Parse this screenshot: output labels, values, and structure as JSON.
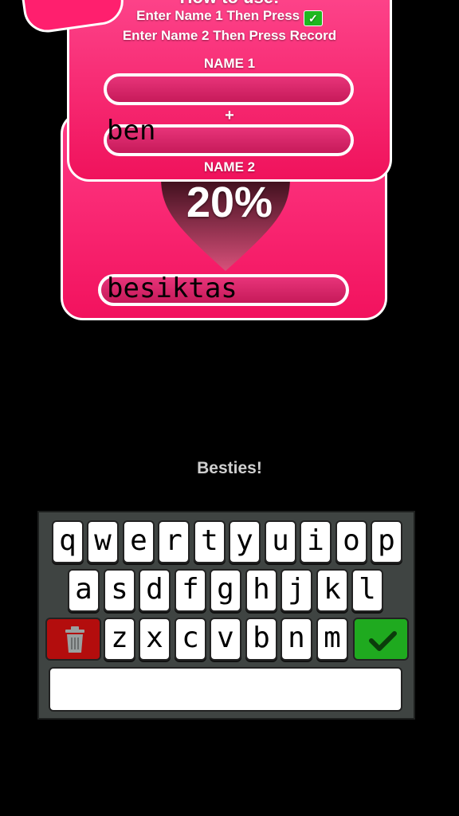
{
  "card": {
    "title": "How to use:",
    "instruction_1": "Enter Name 1 Then Press",
    "instruction_2": "Enter Name 2 Then Press Record",
    "name1_label": "NAME 1",
    "plus": "+",
    "name2_label": "NAME 2",
    "name1_value": "ben",
    "name2_value": "besiktas",
    "percentage": "20%"
  },
  "result_text": "Besties!",
  "keyboard": {
    "row1": [
      "q",
      "w",
      "e",
      "r",
      "t",
      "y",
      "u",
      "i",
      "o",
      "p"
    ],
    "row2": [
      "a",
      "s",
      "d",
      "f",
      "g",
      "h",
      "j",
      "k",
      "l"
    ],
    "row3": [
      "z",
      "x",
      "c",
      "v",
      "b",
      "n",
      "m"
    ],
    "delete_icon": "trash-icon",
    "confirm_icon": "checkmark-icon",
    "input_value": ""
  },
  "colors": {
    "card_pink": "#f2125e",
    "heart": "#2a0a12",
    "delete": "#b30d0d",
    "confirm": "#1faa1f"
  }
}
